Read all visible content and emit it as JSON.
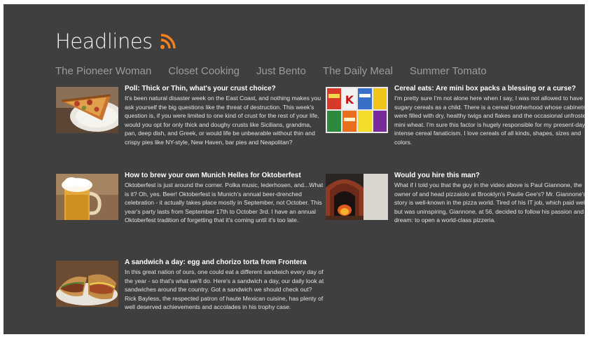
{
  "app": {
    "title": "Headlines",
    "accent": "#f5821f",
    "background": "#3f3f3f",
    "icon": "rss-icon"
  },
  "tabs": [
    {
      "label": "The Pioneer Woman"
    },
    {
      "label": "Closet Cooking"
    },
    {
      "label": "Just Bento"
    },
    {
      "label": "The Daily Meal"
    },
    {
      "label": "Summer Tomato"
    }
  ],
  "articles": [
    {
      "title": "Poll: Thick or Thin, what's your crust choice?",
      "summary": "It's been natural disaster week on the East Coast, and nothing makes you ask yourself the big questions like the threat of destruction. This week's question is, if you were limited to one kind of crust for the rest of your life, would you opt for only thick and doughy crusts like Sicilians, grandma, pan, deep dish, and Greek, or would life be unbearable without thin and crispy pies like NY-style, New Haven, bar pies and Neapolitan?",
      "image": "pizza-slice"
    },
    {
      "title": "Cereal eats: Are mini box packs a blessing or a curse?",
      "summary": "I'm pretty sure I'm not alone here when I say, I was not allowed to have sugary cereals as a child. There is a cereal brotherhood whose cabinets were filled with dry, healthy twigs and flakes and the occasional unfrosted mini wheat. I'm sure this factor is hugely responsible for my present-day intense cereal fanaticism. I love cereals of all kinds, shapes, sizes and colors.",
      "image": "cereal-boxes"
    },
    {
      "title": "How to brew your own Munich Helles for Oktoberfest",
      "summary": "Oktoberfest is just around the corner. Polka music, lederhosen, and...What is it? Oh, yes. Beer! Oktoberfest is Munich's annual beer-drenched celebration - it actually takes place mostly in September, not October. This year's party lasts from September 17th to October 3rd. I have an annual Oktoberfest tradition of forgetting that it's coming until it's too late.",
      "image": "beer-mug"
    },
    {
      "title": "Would you hire this man?",
      "summary": "What if I told you that the guy in the video above is Paul Giannone, the owner of and head pizzaiolo at Brooklyn's Paulie Gee's? Mr. Giannone's story is well-known in the pizza world. Tired of his IT job, which paid well but was uninspiring, Giannone, at 56, decided to follow his passion and his dream: to open a world-class pizzeria.",
      "image": "pizza-oven"
    },
    {
      "title": "A sandwich a day: egg and chorizo torta from Frontera",
      "summary": "In this great nation of ours, one could eat a different sandwich every day of the year - so that's what we'll do. Here's a sandwich a day, our daily look at sandwiches around the country. Got a sandwich we should check out? Rick Bayless, the respected patron of haute Mexican cuisine, has plenty of well deserved achievements and accolades in his trophy case.",
      "image": "sandwich"
    }
  ]
}
